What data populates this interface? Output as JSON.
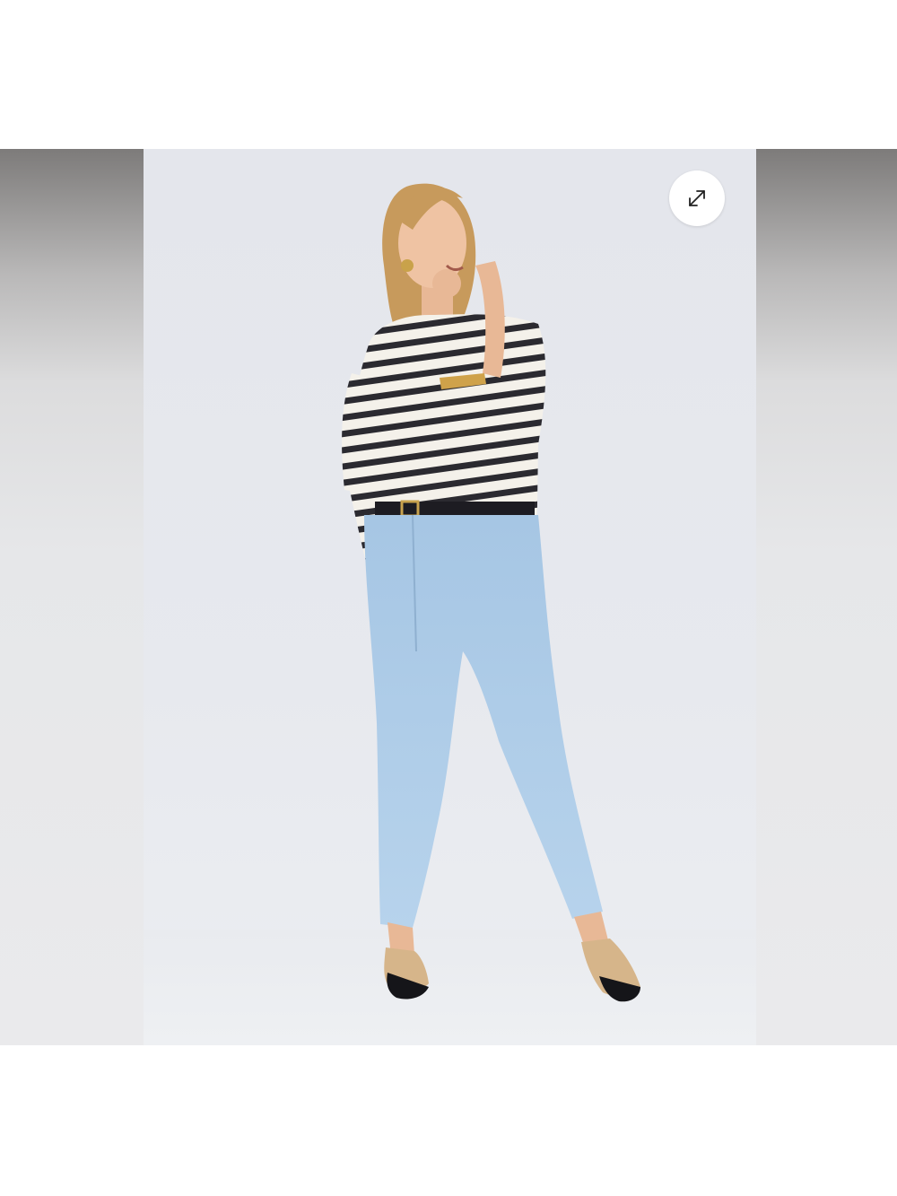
{
  "viewer": {
    "expand_button": {
      "icon": "expand-arrows-icon"
    }
  },
  "colors": {
    "background": "#ffffff",
    "image_backdrop": "#e6e8ed",
    "side_panel_top": "#7d7b7a",
    "side_panel_bottom": "#eaeaec",
    "denim": "#a9c9e6",
    "stripe_dark": "#2b2a30",
    "stripe_light": "#f4f1ea"
  }
}
